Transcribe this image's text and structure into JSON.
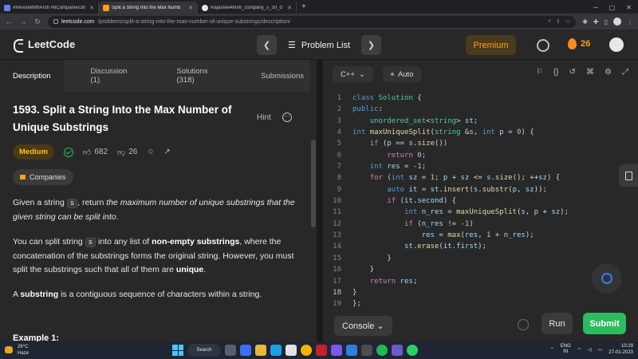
{
  "browser": {
    "tabs": [
      {
        "title": "#ReviseWithArsh #6Companies30",
        "active": false
      },
      {
        "title": "Split a String Into the Max Numb",
        "active": true
      },
      {
        "title": "Rajasree460/6_company_s_30_d",
        "active": false
      }
    ],
    "url_host": "leetcode.com",
    "url_path": "/problems/split-a-string-into-the-max-number-of-unique-substrings/description/"
  },
  "header": {
    "logo_text": "LeetCode",
    "problem_list_label": "Problem List",
    "premium_label": "Premium",
    "streak_count": "26"
  },
  "left_tabs": [
    {
      "label": "Description",
      "active": true
    },
    {
      "label": "Discussion (1)",
      "active": false
    },
    {
      "label": "Solutions (318)",
      "active": false
    },
    {
      "label": "Submissions",
      "active": false
    }
  ],
  "problem": {
    "title": "1593. Split a String Into the Max Number of Unique Substrings",
    "hint_label": "Hint",
    "difficulty": "Medium",
    "likes": "682",
    "dislikes": "26",
    "companies_label": "Companies",
    "p1_pre": "Given a string ",
    "p1_code": "s",
    "p1_mid": ", return ",
    "p1_em": "the maximum number of unique substrings that the given string can be split into",
    "p1_end": ".",
    "p2_a": "You can split string ",
    "p2_code": "s",
    "p2_b": " into any list of ",
    "p2_strong1": "non-empty substrings",
    "p2_c": ", where the concatenation of the substrings forms the original string. However, you must split the substrings such that all of them are ",
    "p2_strong2": "unique",
    "p2_d": ".",
    "p3_a": "A ",
    "p3_strong": "substring",
    "p3_b": " is a contiguous sequence of characters within a string.",
    "example_heading": "Example 1:"
  },
  "editor": {
    "language": "C++",
    "mode": "Auto",
    "current_line": 18,
    "lines": [
      "class Solution {",
      "public:",
      "    unordered_set<string> st;",
      "int maxUniqueSplit(string &s, int p = 0) {",
      "    if (p == s.size())",
      "        return 0;",
      "    int res = -1;",
      "    for (int sz = 1; p + sz <= s.size(); ++sz) {",
      "        auto it = st.insert(s.substr(p, sz));",
      "        if (it.second) {",
      "            int n_res = maxUniqueSplit(s, p + sz);",
      "            if (n_res != -1)",
      "                res = max(res, 1 + n_res);",
      "            st.erase(it.first);",
      "        }",
      "    }",
      "    return res;",
      "}",
      "};"
    ],
    "console_label": "Console",
    "run_label": "Run",
    "submit_label": "Submit"
  },
  "taskbar": {
    "weather_temp": "26°C",
    "weather_desc": "Haze",
    "search_label": "Search",
    "lang_top": "ENG",
    "lang_bottom": "IN",
    "time": "10:29",
    "date": "27-01-2023"
  }
}
